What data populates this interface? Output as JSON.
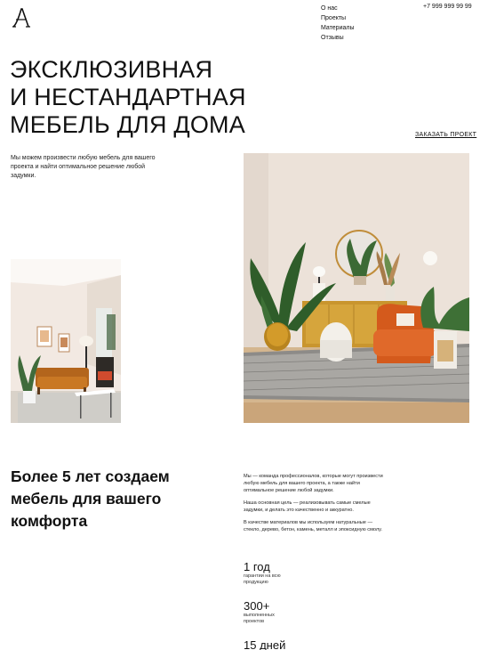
{
  "header": {
    "logo_label": "A",
    "nav": [
      "О нас",
      "Проекты",
      "Материалы",
      "Отзывы"
    ],
    "phone": "+7 999 999 99 99"
  },
  "hero": {
    "title_lines": [
      "ЭКСКЛЮЗИВНАЯ",
      "И НЕСТАНДАРТНАЯ",
      "МЕБЕЛЬ ДЛЯ ДОМА"
    ],
    "cta": "ЗАКАЗАТЬ ПРОЕКТ",
    "description": "Мы можем произвести любую мебель для вашего проекта и найти оптимальное решение любой задумки."
  },
  "about": {
    "title_lines": [
      "Более 5 лет создаем",
      "мебель для вашего",
      "комфорта"
    ],
    "paragraphs": [
      "Мы — команда профессионалов, которые могут произвести любую мебель для вашего проекта, а также найти оптимальное решение любой задумки.",
      "Наша основная цель — реализовывать самые смелые задумки, и делать это качественно и аккуратно.",
      "В качестве материалов мы используем натуральные — стекло, дерево, бетон, камень, металл и эпоксидную смолу."
    ],
    "stats": [
      {
        "value": "1 год",
        "label": "гарантии на всю продукцию"
      },
      {
        "value": "300+",
        "label": "выполненных проектов"
      },
      {
        "value": "15 дней",
        "label": ""
      }
    ]
  }
}
